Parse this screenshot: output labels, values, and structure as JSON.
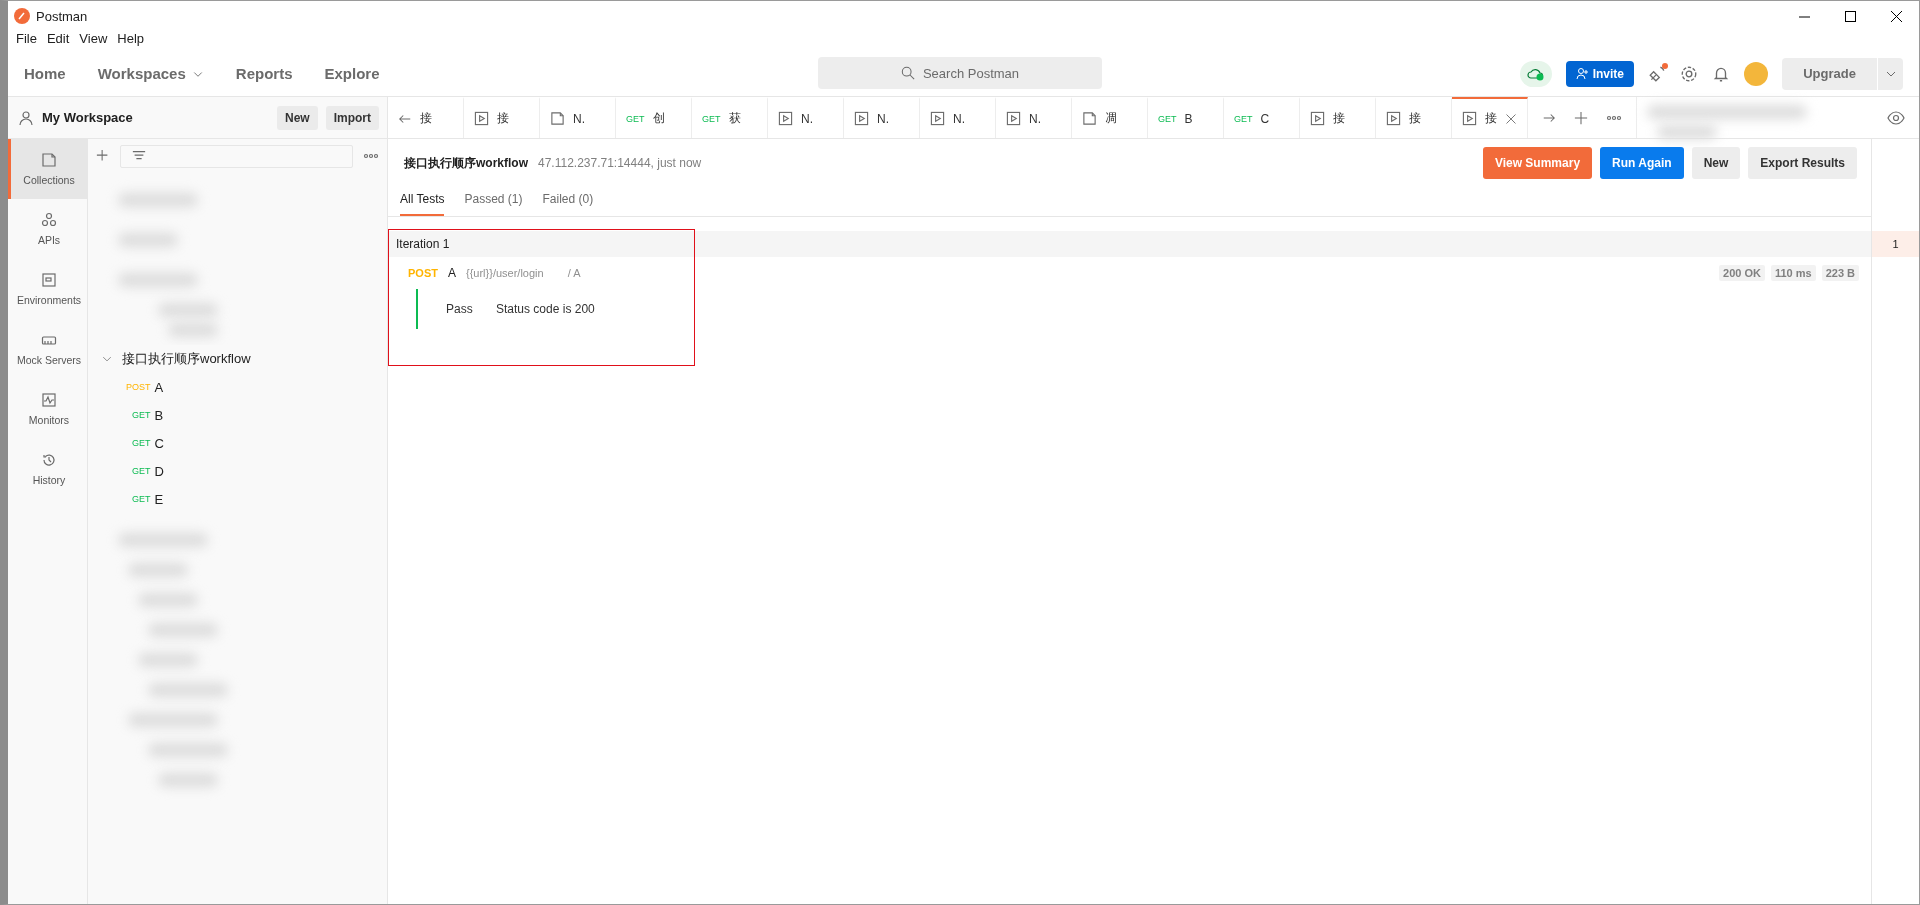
{
  "window": {
    "title": "Postman"
  },
  "menu": [
    "File",
    "Edit",
    "View",
    "Help"
  ],
  "nav": {
    "items": [
      {
        "label": "Home",
        "dropdown": false
      },
      {
        "label": "Workspaces",
        "dropdown": true
      },
      {
        "label": "Reports",
        "dropdown": false
      },
      {
        "label": "Explore",
        "dropdown": false
      }
    ],
    "search": {
      "placeholder": "Search Postman"
    },
    "invite": "Invite",
    "upgrade": "Upgrade"
  },
  "sidebar": {
    "workspace": "My Workspace",
    "buttons": [
      "New",
      "Import"
    ],
    "rail": [
      {
        "label": "Collections",
        "selected": true
      },
      {
        "label": "APIs",
        "selected": false
      },
      {
        "label": "Environments",
        "selected": false
      },
      {
        "label": "Mock Servers",
        "selected": false
      },
      {
        "label": "Monitors",
        "selected": false
      },
      {
        "label": "History",
        "selected": false
      }
    ],
    "collection": {
      "name": "接口执行顺序workflow",
      "expanded": true,
      "requests": [
        {
          "method": "POST",
          "name": "A"
        },
        {
          "method": "GET",
          "name": "B"
        },
        {
          "method": "GET",
          "name": "C"
        },
        {
          "method": "GET",
          "name": "D"
        },
        {
          "method": "GET",
          "name": "E"
        }
      ]
    }
  },
  "tabs": [
    {
      "kind": "history",
      "label": "接",
      "selected": false
    },
    {
      "kind": "runner",
      "label": "接",
      "selected": false
    },
    {
      "kind": "collection",
      "label": "N.",
      "selected": false
    },
    {
      "kind": "request",
      "method": "GET",
      "label": "创",
      "selected": false
    },
    {
      "kind": "request",
      "method": "GET",
      "label": "获",
      "selected": false
    },
    {
      "kind": "runner",
      "label": "N.",
      "selected": false
    },
    {
      "kind": "runner",
      "label": "N.",
      "selected": false
    },
    {
      "kind": "runner",
      "label": "N.",
      "selected": false
    },
    {
      "kind": "runner",
      "label": "N.",
      "selected": false
    },
    {
      "kind": "collection",
      "label": "凋",
      "selected": false
    },
    {
      "kind": "request",
      "method": "GET",
      "label": "B",
      "selected": false
    },
    {
      "kind": "request",
      "method": "GET",
      "label": "C",
      "selected": false
    },
    {
      "kind": "runner",
      "label": "接",
      "selected": false
    },
    {
      "kind": "runner",
      "label": "接",
      "selected": false
    },
    {
      "kind": "runner",
      "label": "接",
      "selected": true
    }
  ],
  "runner": {
    "title": "接口执行顺序workflow",
    "meta": "47.112.237.71:14444, just now",
    "actions": [
      {
        "label": "View Summary",
        "kind": "accent"
      },
      {
        "label": "Run Again",
        "kind": "primary"
      },
      {
        "label": "New",
        "kind": "plain"
      },
      {
        "label": "Export Results",
        "kind": "plain"
      }
    ],
    "filters": [
      {
        "label": "All Tests",
        "selected": true
      },
      {
        "label": "Passed (1)",
        "selected": false
      },
      {
        "label": "Failed (0)",
        "selected": false
      }
    ],
    "iterations": [
      {
        "label": "Iteration 1",
        "requests": [
          {
            "method": "POST",
            "name": "A",
            "url": "{{url}}/user/login",
            "path": "/ A",
            "status": "200 OK",
            "time": "110 ms",
            "size": "223 B",
            "tests": [
              {
                "result": "Pass",
                "name": "Status code is 200",
                "passed": true
              }
            ]
          }
        ]
      }
    ],
    "iteration_index": [
      {
        "label": "1",
        "selected": true
      }
    ]
  }
}
